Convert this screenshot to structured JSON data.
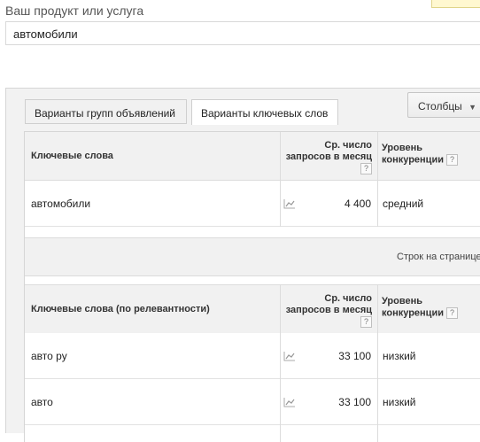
{
  "product": {
    "label": "Ваш продукт или услуга",
    "value": "автомобили"
  },
  "tabs": [
    {
      "label": "Варианты групп объявлений"
    },
    {
      "label": "Варианты ключевых слов"
    }
  ],
  "columns_button": {
    "label": "Столбцы",
    "caret": "▼"
  },
  "table1": {
    "headers": {
      "keyword": "Ключевые слова",
      "volume_line1": "Ср. число",
      "volume_line2": "запросов в месяц",
      "competition_line1": "Уровень",
      "competition_line2": "конкуренции",
      "help": "?"
    },
    "rows": [
      {
        "keyword": "автомобили",
        "volume": "4 400",
        "competition": "средний"
      }
    ]
  },
  "pager": {
    "rows_per_page": "Строк на странице"
  },
  "table2": {
    "headers": {
      "keyword": "Ключевые слова (по релевантности)",
      "volume_line1": "Ср. число",
      "volume_line2": "запросов в месяц",
      "competition_line1": "Уровень",
      "competition_line2": "конкуренции",
      "help": "?"
    },
    "rows": [
      {
        "keyword": "авто ру",
        "volume": "33 100",
        "competition": "низкий"
      },
      {
        "keyword": "авто",
        "volume": "33 100",
        "competition": "низкий"
      }
    ]
  },
  "colors": {
    "header_bg": "#f1f1f1",
    "panel_bg": "#f2f2f2",
    "tooltip_bg": "#fff8d0"
  },
  "icons": {
    "trend": "line-chart-icon",
    "help": "question-icon"
  }
}
